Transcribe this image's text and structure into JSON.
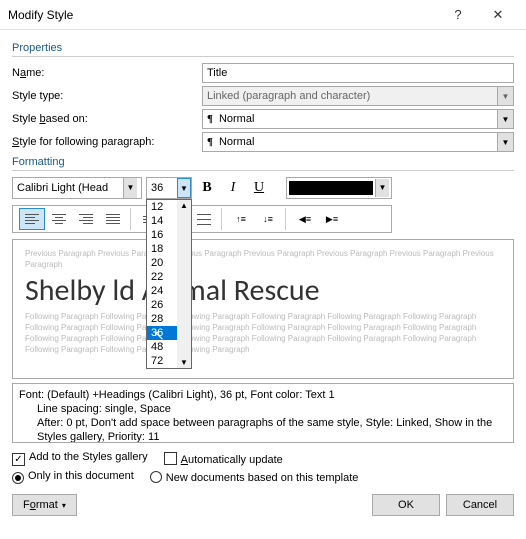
{
  "window": {
    "title": "Modify Style"
  },
  "sections": {
    "properties": "Properties",
    "formatting": "Formatting"
  },
  "labels": {
    "name_pre": "N",
    "name_ul": "a",
    "name_post": "me:",
    "styletype": "Style type:",
    "based_pre": "Style ",
    "based_ul": "b",
    "based_post": "ased on:",
    "follow_pre": "",
    "follow_ul": "S",
    "follow_post": "tyle for following paragraph:"
  },
  "fields": {
    "name": "Title",
    "styletype": "Linked (paragraph and character)",
    "basedon": "Normal",
    "following": "Normal"
  },
  "font": {
    "name": "Calibri Light (Head",
    "size": "36"
  },
  "size_options": [
    "12",
    "14",
    "16",
    "18",
    "20",
    "22",
    "24",
    "26",
    "28",
    "36",
    "48",
    "72"
  ],
  "size_selected_index": 9,
  "format_buttons": {
    "bold": "B",
    "italic": "I",
    "underline": "U"
  },
  "preview": {
    "prev_text": "Previous Paragraph Previous Paragraph Previous Paragraph Previous Paragraph Previous Paragraph Previous Paragraph Previous Paragraph",
    "sample": "Shelby     ld Animal Rescue",
    "follow_text": "Following Paragraph Following Paragraph Following Paragraph Following Paragraph Following Paragraph Following Paragraph Following Paragraph Following Paragraph Following Paragraph Following Paragraph Following Paragraph Following Paragraph Following Paragraph Following Paragraph Following Paragraph Following Paragraph Following Paragraph Following Paragraph Following Paragraph Following Paragraph Following Paragraph"
  },
  "description": {
    "line1": "Font: (Default) +Headings (Calibri Light), 36 pt, Font color: Text 1",
    "line2": "Line spacing:  single, Space",
    "line3": "After:  0 pt, Don't add space between paragraphs of the same style, Style: Linked, Show in the Styles gallery, Priority: 11"
  },
  "checks": {
    "add_gallery": "Add to the Styles gallery",
    "auto_update": "Automatically update",
    "only_doc": "Only in this document",
    "new_docs": "New documents based on this template"
  },
  "buttons": {
    "format": "Format",
    "ok": "OK",
    "cancel": "Cancel"
  },
  "pilcrow": "¶"
}
